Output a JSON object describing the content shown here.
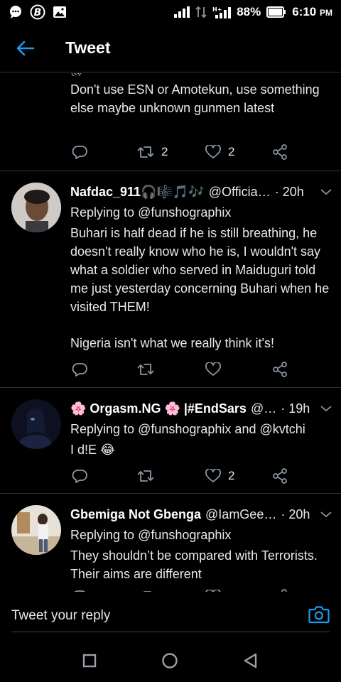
{
  "status_bar": {
    "battery": "88%",
    "time": "6:10",
    "time_suffix": "PM",
    "network_label": "H+"
  },
  "header": {
    "title": "Tweet"
  },
  "tweets": [
    {
      "partial_top": "@",
      "text": "Don't use ESN or Amotekun, use something else maybe unknown gunmen latest",
      "retweets": "2",
      "likes": "2"
    },
    {
      "name": "Nafdac_911",
      "name_emoji": "🎧🎼🎵🎶",
      "handle": "@Officia…",
      "time": "· 20h",
      "replying_label": "Replying to",
      "replying_to": "@funshographix",
      "text_1": "Buhari is half dead if he is still breathing, he doesn't really know who he is, I wouldn't say what a soldier who served in Maiduguri told me just yesterday concerning Buhari when he visited THEM!",
      "text_2": "Nigeria isn't what we really think it's!",
      "retweets": "",
      "likes": ""
    },
    {
      "name": "🌸 Orgasm.NG 🌸 |#EndSars",
      "handle": "@…",
      "time": "· 19h",
      "replying_label": "Replying to",
      "replying_to": "@funshographix and @kvtchi",
      "text": "I d!E 😂",
      "retweets": "",
      "likes": "2"
    },
    {
      "name": "Gbemiga Not Gbenga",
      "handle": "@IamGee…",
      "time": "· 20h",
      "replying_label": "Replying to",
      "replying_to": "@funshographix",
      "text": "They shouldn’t be compared with Terrorists. Their aims are different"
    }
  ],
  "reply_bar": {
    "placeholder": "Tweet your reply"
  },
  "colors": {
    "accent": "#1d9bf0",
    "background": "#000000",
    "divider": "#2f3336"
  }
}
